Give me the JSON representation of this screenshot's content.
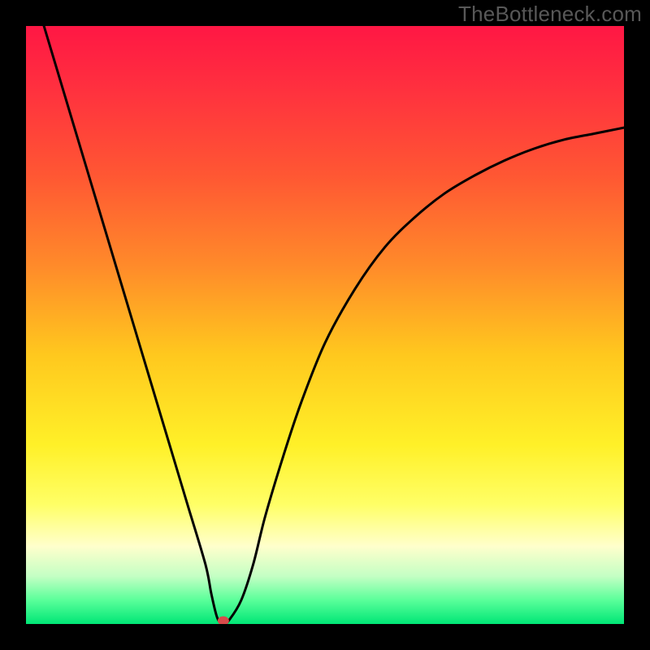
{
  "watermark": "TheBottleneck.com",
  "chart_data": {
    "type": "line",
    "title": "",
    "xlabel": "",
    "ylabel": "",
    "xlim": [
      0,
      100
    ],
    "ylim": [
      0,
      100
    ],
    "grid": false,
    "background_gradient": {
      "stops": [
        {
          "offset": 0.0,
          "color": "#ff1744"
        },
        {
          "offset": 0.1,
          "color": "#ff2f3f"
        },
        {
          "offset": 0.25,
          "color": "#ff5733"
        },
        {
          "offset": 0.4,
          "color": "#ff8a2a"
        },
        {
          "offset": 0.55,
          "color": "#ffc81e"
        },
        {
          "offset": 0.7,
          "color": "#fff028"
        },
        {
          "offset": 0.8,
          "color": "#ffff66"
        },
        {
          "offset": 0.87,
          "color": "#ffffcc"
        },
        {
          "offset": 0.92,
          "color": "#c4ffc4"
        },
        {
          "offset": 0.96,
          "color": "#5aff9a"
        },
        {
          "offset": 1.0,
          "color": "#00e676"
        }
      ]
    },
    "series": [
      {
        "name": "bottleneck-curve",
        "color": "#000000",
        "x": [
          3,
          6,
          9,
          12,
          15,
          18,
          21,
          24,
          27,
          30,
          31,
          32,
          33,
          34,
          36,
          38,
          40,
          43,
          46,
          50,
          55,
          60,
          65,
          70,
          75,
          80,
          85,
          90,
          95,
          100
        ],
        "y": [
          100,
          90,
          80,
          70,
          60,
          50,
          40,
          30,
          20,
          10,
          5,
          1,
          0,
          0.7,
          4,
          10,
          18,
          28,
          37,
          47,
          56,
          63,
          68,
          72,
          75,
          77.5,
          79.5,
          81,
          82,
          83
        ]
      }
    ],
    "marker": {
      "name": "optimal-point",
      "x": 33,
      "y": 0,
      "radius": 6,
      "color": "#d84a4a"
    }
  }
}
